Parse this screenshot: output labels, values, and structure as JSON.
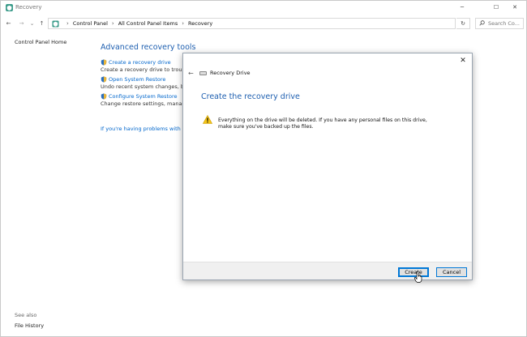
{
  "window": {
    "title": "Recovery",
    "controls": {
      "minimize": "─",
      "maximize": "☐",
      "close": "✕"
    }
  },
  "nav": {
    "back_icon": "←",
    "forward_icon": "→",
    "recent_icon": "⌄",
    "up_icon": "↑",
    "breadcrumb": [
      "Control Panel",
      "All Control Panel Items",
      "Recovery"
    ],
    "breadcrumb_sep": "›",
    "refresh_icon": "↻",
    "search_placeholder": "Search Co..."
  },
  "sidebar": {
    "home": "Control Panel Home",
    "see_also": "See also",
    "file_history": "File History"
  },
  "main": {
    "heading": "Advanced recovery tools",
    "tools": [
      {
        "label": "Create a recovery drive",
        "desc": "Create a recovery drive to troublesh"
      },
      {
        "label": "Open System Restore",
        "desc": "Undo recent system changes, but le"
      },
      {
        "label": "Configure System Restore",
        "desc": "Change restore settings, manage di"
      }
    ],
    "trouble_link": "If you're having problems with your"
  },
  "dialog": {
    "close_icon": "✕",
    "back_icon": "←",
    "app_name": "Recovery Drive",
    "title": "Create the recovery drive",
    "warning": "Everything on the drive will be deleted. If you have any personal files on this drive, make sure you've backed up the files.",
    "create_label": "Create",
    "cancel_label": "Cancel"
  }
}
